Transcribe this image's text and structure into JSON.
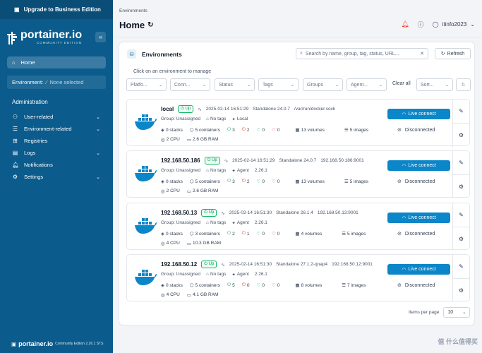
{
  "sidebar": {
    "upgrade_label": "Upgrade to Business Edition",
    "logo_text": "portainer.io",
    "logo_sub": "COMMUNITY EDITION",
    "collapse_icon": "«",
    "home_label": "Home",
    "environment_label": "Environment:",
    "environment_value": "None selected",
    "admin_label": "Administration",
    "nav": [
      {
        "label": "User-related",
        "has_chevron": true
      },
      {
        "label": "Environment-related",
        "has_chevron": true
      },
      {
        "label": "Registries",
        "has_chevron": false
      },
      {
        "label": "Logs",
        "has_chevron": true
      },
      {
        "label": "Notifications",
        "has_chevron": false
      },
      {
        "label": "Settings",
        "has_chevron": true
      }
    ],
    "footer_brand": "portainer.io",
    "footer_version": "Community Edition 2.26.1 STS"
  },
  "header": {
    "breadcrumb": "Environments",
    "title": "Home",
    "username": "itinfo2023"
  },
  "panel": {
    "title": "Environments",
    "search_placeholder": "Search by name, group, tag, status, URL...",
    "refresh_label": "Refresh",
    "hint": "Click on an environment to manage",
    "filters": [
      "Platfo...",
      "Conn...",
      "Status",
      "Tags",
      "Groups",
      "Agent..."
    ],
    "clear_all": "Clear all",
    "sort": "Sort...",
    "items_per_page_label": "Items per page",
    "items_per_page": "10"
  },
  "environments": [
    {
      "name": "local",
      "status": "Up",
      "date": "2025-02-14 16:51:29",
      "type": "Standalone 24.0.7",
      "url": "/var/run/docker.sock",
      "group": "Group: Unassigned",
      "tags": "No tags",
      "agent": "Local",
      "agent_version": "",
      "stacks": "0 stacks",
      "containers": "5 containers",
      "running": "3",
      "stopped": "2",
      "healthy": "0",
      "unhealthy": "0",
      "volumes": "13 volumes",
      "images": "5 images",
      "cpu": "2 CPU",
      "ram": "2.6 GB RAM",
      "live_label": "Live connect",
      "disconnected": "Disconnected"
    },
    {
      "name": "192.168.50.186",
      "status": "Up",
      "date": "2025-02-14 16:51:29",
      "type": "Standalone 24.0.7",
      "url": "192.168.50.186:9001",
      "group": "Group: Unassigned",
      "tags": "No tags",
      "agent": "Agent",
      "agent_version": "2.26.1",
      "stacks": "0 stacks",
      "containers": "5 containers",
      "running": "3",
      "stopped": "2",
      "healthy": "0",
      "unhealthy": "0",
      "volumes": "13 volumes",
      "images": "5 images",
      "cpu": "2 CPU",
      "ram": "2.6 GB RAM",
      "live_label": "Live connect",
      "disconnected": "Disconnected"
    },
    {
      "name": "192.168.50.13",
      "status": "Up",
      "date": "2025-02-14 16:51:30",
      "type": "Standalone 26.1.4",
      "url": "192.168.50.13:9001",
      "group": "Group: Unassigned",
      "tags": "No tags",
      "agent": "Agent",
      "agent_version": "2.26.1",
      "stacks": "0 stacks",
      "containers": "3 containers",
      "running": "2",
      "stopped": "1",
      "healthy": "0",
      "unhealthy": "0",
      "volumes": "4 volumes",
      "images": "5 images",
      "cpu": "4 CPU",
      "ram": "10.3 GB RAM",
      "live_label": "Live connect",
      "disconnected": "Disconnected"
    },
    {
      "name": "192.168.50.12",
      "status": "Up",
      "date": "2025-02-14 16:51:30",
      "type": "Standalone 27.1.2-qnap4",
      "url": "192.168.50.12:9001",
      "group": "Group: Unassigned",
      "tags": "No tags",
      "agent": "Agent",
      "agent_version": "2.26.1",
      "stacks": "0 stacks",
      "containers": "5 containers",
      "running": "5",
      "stopped": "0",
      "healthy": "0",
      "unhealthy": "0",
      "volumes": "8 volumes",
      "images": "7 images",
      "cpu": "4 CPU",
      "ram": "4.1 GB RAM",
      "live_label": "Live connect",
      "disconnected": "Disconnected"
    }
  ],
  "watermark": "值 什么值得买",
  "colors": {
    "sidebar": "#0b5b8c",
    "accent": "#0b86c8",
    "up": "#12b76a",
    "stopped": "#f04438"
  }
}
